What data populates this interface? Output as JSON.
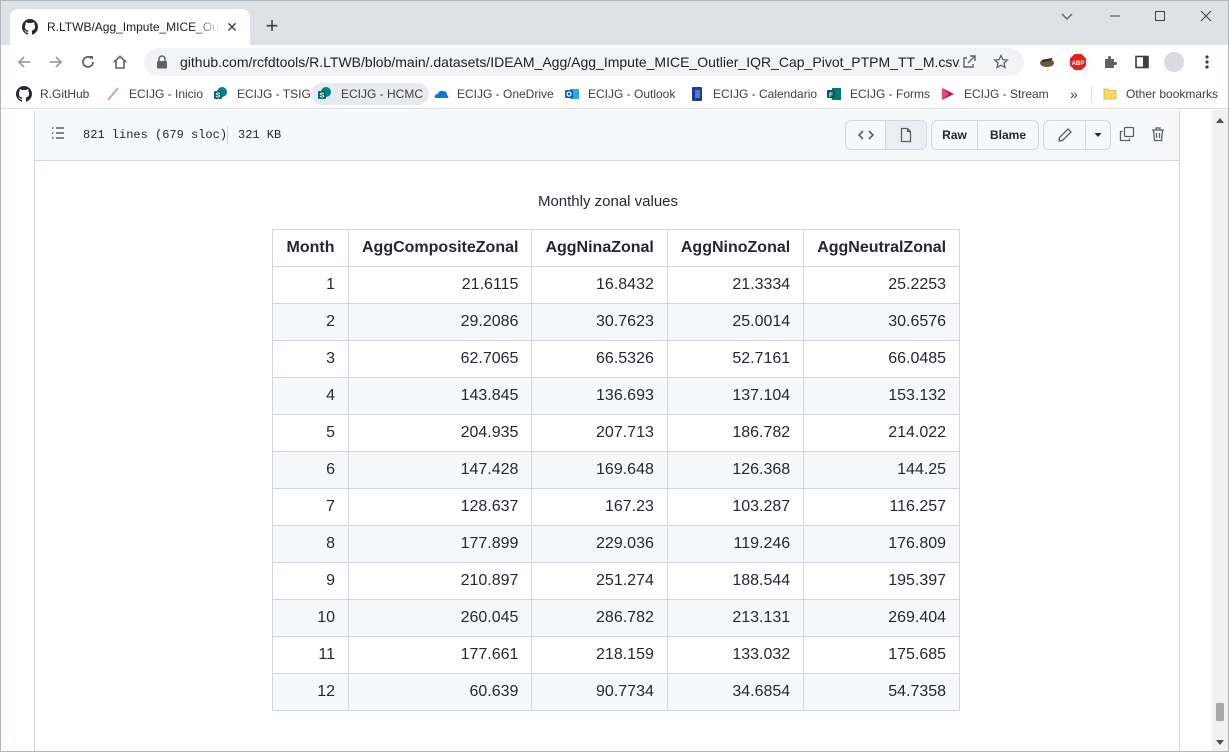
{
  "browser": {
    "tab_title": "R.LTWB/Agg_Impute_MICE_Outlier_IQR_Cap_Pivot_PTPM_TT_M.csv.md at main · rcfdtools/R.LTWB",
    "url": "github.com/rcfdtools/R.LTWB/blob/main/.datasets/IDEAM_Agg/Agg_Impute_MICE_Outlier_IQR_Cap_Pivot_PTPM_TT_M.csv.md",
    "close_glyph": "✕",
    "newtab_glyph": "+"
  },
  "bookmarks": [
    {
      "label": "R.GitHub",
      "icon": "github-icon"
    },
    {
      "label": "ECIJG - Inicio",
      "icon": "ecijg-icon"
    },
    {
      "label": "ECIJG - TSIG",
      "icon": "sharepoint-icon"
    },
    {
      "label": "ECIJG - HCMC",
      "icon": "sharepoint-icon"
    },
    {
      "label": "ECIJG - OneDrive",
      "icon": "onedrive-icon"
    },
    {
      "label": "ECIJG - Outlook",
      "icon": "outlook-icon"
    },
    {
      "label": "ECIJG - Calendario",
      "icon": "calendar-icon"
    },
    {
      "label": "ECIJG - Forms",
      "icon": "forms-icon"
    },
    {
      "label": "ECIJG - Stream",
      "icon": "stream-icon"
    }
  ],
  "bookmarks_overflow": "»",
  "other_bookmarks": "Other bookmarks",
  "file": {
    "lines": "821 lines (679 sloc)",
    "size": "321 KB",
    "raw_label": "Raw",
    "blame_label": "Blame"
  },
  "table": {
    "caption": "Monthly zonal values",
    "headers": [
      "Month",
      "AggCompositeZonal",
      "AggNinaZonal",
      "AggNinoZonal",
      "AggNeutralZonal"
    ],
    "rows": [
      [
        "1",
        "21.6115",
        "16.8432",
        "21.3334",
        "25.2253"
      ],
      [
        "2",
        "29.2086",
        "30.7623",
        "25.0014",
        "30.6576"
      ],
      [
        "3",
        "62.7065",
        "66.5326",
        "52.7161",
        "66.0485"
      ],
      [
        "4",
        "143.845",
        "136.693",
        "137.104",
        "153.132"
      ],
      [
        "5",
        "204.935",
        "207.713",
        "186.782",
        "214.022"
      ],
      [
        "6",
        "147.428",
        "169.648",
        "126.368",
        "144.25"
      ],
      [
        "7",
        "128.637",
        "167.23",
        "103.287",
        "116.257"
      ],
      [
        "8",
        "177.899",
        "229.036",
        "119.246",
        "176.809"
      ],
      [
        "9",
        "210.897",
        "251.274",
        "188.544",
        "195.397"
      ],
      [
        "10",
        "260.045",
        "286.782",
        "213.131",
        "269.404"
      ],
      [
        "11",
        "177.661",
        "218.159",
        "133.032",
        "175.685"
      ],
      [
        "12",
        "60.639",
        "90.7734",
        "34.6854",
        "54.7358"
      ]
    ]
  }
}
